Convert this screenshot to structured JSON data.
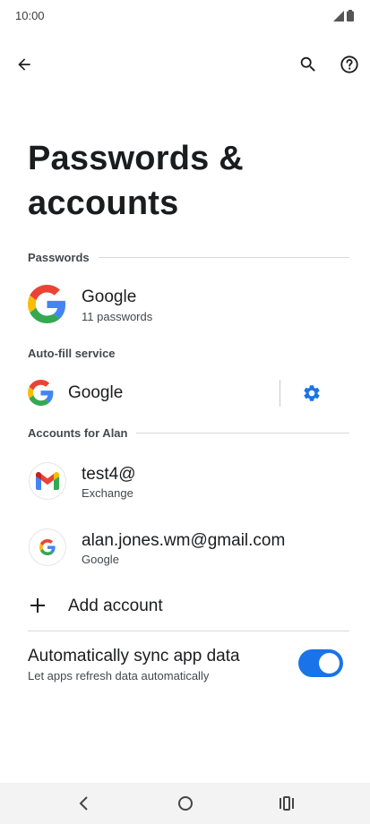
{
  "status_bar": {
    "time": "10:00"
  },
  "page": {
    "title": "Passwords & accounts"
  },
  "sections": {
    "passwords": "Passwords",
    "autofill": "Auto-fill service",
    "accounts": "Accounts for Alan"
  },
  "passwords_item": {
    "title": "Google",
    "subtitle": "11 passwords",
    "icon": "google-g-icon"
  },
  "autofill_item": {
    "title": "Google",
    "icon": "google-g-icon",
    "action_icon": "gear-icon"
  },
  "accounts": [
    {
      "title": "test4@",
      "subtitle": "Exchange",
      "icon": "gmail-icon"
    },
    {
      "title": "alan.jones.wm@gmail.com",
      "subtitle": "Google",
      "icon": "google-g-icon"
    }
  ],
  "add_account": {
    "label": "Add account",
    "icon": "plus-icon"
  },
  "sync": {
    "title": "Automatically sync app data",
    "subtitle": "Let apps refresh data automatically",
    "enabled": true
  },
  "colors": {
    "accent": "#1a73e8",
    "google_blue": "#4285F4",
    "google_red": "#EA4335",
    "google_yellow": "#FBBC05",
    "google_green": "#34A853"
  }
}
